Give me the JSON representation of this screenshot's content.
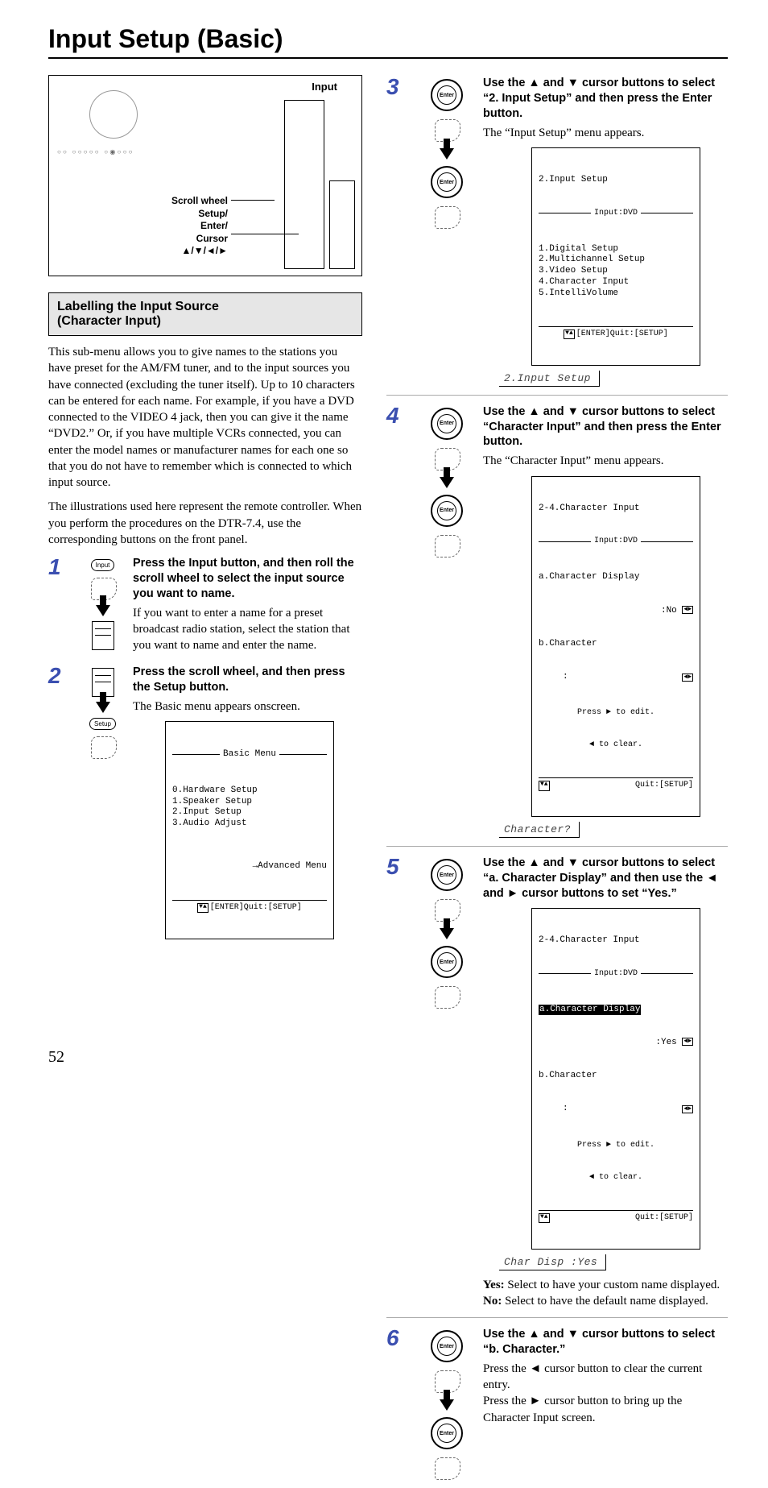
{
  "page": {
    "title": "Input Setup (Basic)",
    "number": "52"
  },
  "diagram": {
    "input_label": "Input",
    "labels": {
      "scroll_wheel": "Scroll wheel",
      "setup": "Setup/",
      "enter": "Enter/",
      "cursor": "Cursor",
      "arrows": "▲/▼/◄/►"
    }
  },
  "section": {
    "title_line1": "Labelling the Input Source",
    "title_line2": "(Character Input)"
  },
  "para1": "This sub-menu allows you to give names to the stations you have preset for the AM/FM tuner, and to the input sources you have connected (excluding the tuner itself). Up to 10 characters can be entered for each name. For example, if you have a DVD connected to the VIDEO 4 jack, then you can give it the name “DVD2.” Or, if you have multiple VCRs connected, you can enter the model names or manufacturer names for each one so that you do not have to remember which is connected to which input source.",
  "para2": "The illustrations used here represent the remote controller. When you perform the procedures on the DTR-7.4, use the corresponding buttons on the front panel.",
  "steps": {
    "s1": {
      "num": "1",
      "head": "Press the Input button, and then roll the scroll wheel to select the input source you want to name.",
      "body": "If you want to enter a name for a preset broadcast radio station, select the station that you want to name and enter the name.",
      "btn_label": "Input"
    },
    "s2": {
      "num": "2",
      "head": "Press the scroll wheel, and then press the Setup button.",
      "body": "The Basic menu appears onscreen.",
      "btn_label": "Setup",
      "osd": {
        "title": "Basic Menu",
        "items": "0.Hardware Setup\n1.Speaker Setup\n2.Input Setup\n3.Audio Adjust",
        "adv": "→Advanced Menu",
        "footer": "[ENTER]Quit:[SETUP]"
      }
    },
    "s3": {
      "num": "3",
      "head": "Use the ▲ and ▼ cursor buttons to select “2. Input Setup” and then press the Enter button.",
      "body": "The “Input Setup” menu appears.",
      "osd": {
        "title": "2.Input Setup",
        "subtitle": "Input:DVD",
        "items": "1.Digital Setup\n2.Multichannel Setup\n3.Video Setup\n4.Character Input\n5.IntelliVolume",
        "footer": "[ENTER]Quit:[SETUP]"
      },
      "lcd": "2.Input Setup"
    },
    "s4": {
      "num": "4",
      "head": "Use the ▲ and ▼ cursor buttons to select “Character Input” and then press the Enter button.",
      "body": "The “Character Input” menu appears.",
      "osd": {
        "title": "2-4.Character Input",
        "subtitle": "Input:DVD",
        "row_a": "a.Character Display",
        "row_a_val": ":No",
        "row_b": "b.Character",
        "row_b_val": ":",
        "hint1": "Press ► to edit.",
        "hint2": "◄ to clear.",
        "footer": "Quit:[SETUP]"
      },
      "lcd": "Character?"
    },
    "s5": {
      "num": "5",
      "head": "Use the ▲ and ▼ cursor buttons to select “a. Character Display” and then use the ◄ and ► cursor buttons to set “Yes.”",
      "osd": {
        "title": "2-4.Character Input",
        "subtitle": "Input:DVD",
        "row_a": "a.Character Display",
        "row_a_val": ":Yes",
        "row_b": "b.Character",
        "row_b_val": ":",
        "hint1": "Press ► to edit.",
        "hint2": "◄ to clear.",
        "footer": "Quit:[SETUP]"
      },
      "lcd": "Char Disp :Yes",
      "yes_label": "Yes:",
      "yes_text": " Select to have your custom name displayed.",
      "no_label": "No:",
      "no_text": " Select to have the default name displayed."
    },
    "s6": {
      "num": "6",
      "head": "Use the ▲ and ▼ cursor buttons to select “b. Character.”",
      "body1a": "Press the ",
      "body1b": " cursor button to clear the current entry.",
      "body2a": "Press the ",
      "body2b": " cursor button to bring up the Character Input screen."
    }
  },
  "icon_text": {
    "enter": "Enter",
    "ud": "▼▲",
    "lr": "◄►"
  }
}
